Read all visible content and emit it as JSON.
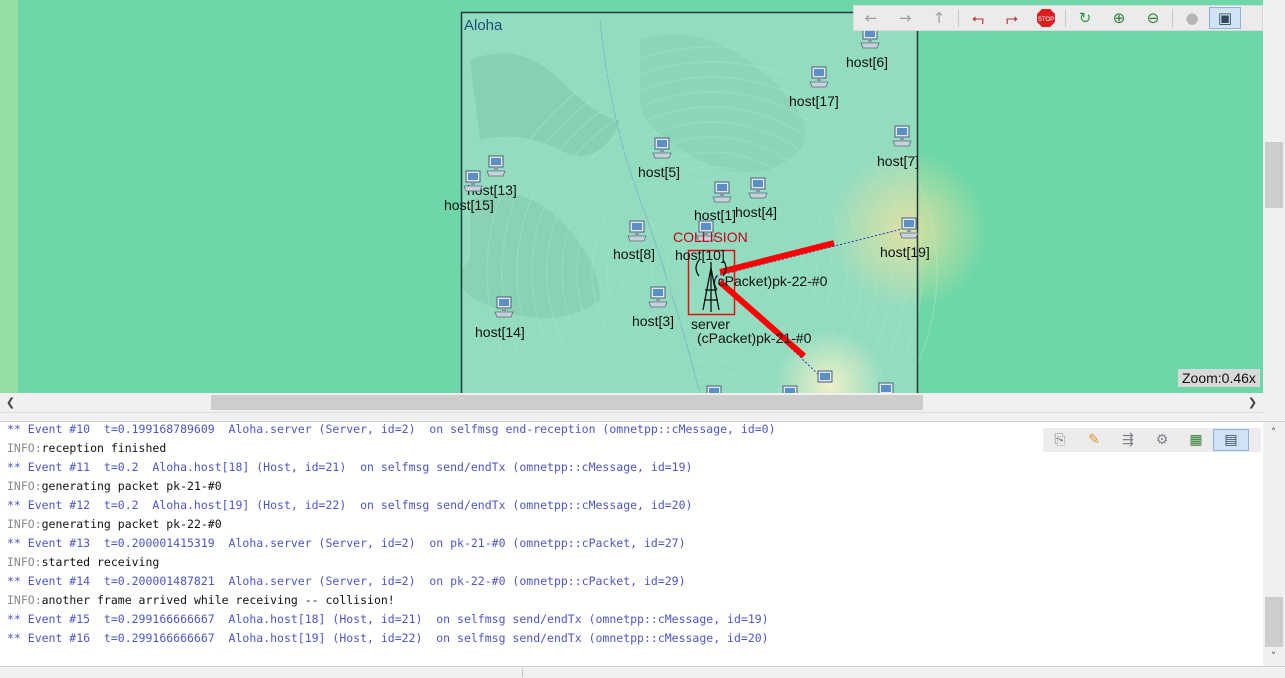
{
  "network": {
    "title": "Aloha",
    "collision_label": "COLLISION",
    "zoom": "Zoom:0.46x",
    "hosts": [
      {
        "name": "host[6]"
      },
      {
        "name": "host[17]"
      },
      {
        "name": "host[7]"
      },
      {
        "name": "host[5]"
      },
      {
        "name": "host[13]"
      },
      {
        "name": "host[15]"
      },
      {
        "name": "host[1]"
      },
      {
        "name": "host[4]"
      },
      {
        "name": "host[10]"
      },
      {
        "name": "host[8]"
      },
      {
        "name": "host[19]"
      },
      {
        "name": "host[3]"
      },
      {
        "name": "host[14]"
      }
    ],
    "server": "server",
    "packets": [
      {
        "label": "(cPacket)pk-22-#0"
      },
      {
        "label": "(cPacket)pk-21-#0"
      }
    ]
  },
  "toolbar": {
    "buttons": [
      {
        "name": "back-icon"
      },
      {
        "name": "forward-icon"
      },
      {
        "name": "up-icon"
      },
      {
        "name": "animate-slower-icon"
      },
      {
        "name": "animate-faster-icon"
      },
      {
        "name": "stop-icon"
      },
      {
        "name": "relayout-icon"
      },
      {
        "name": "zoom-in-icon"
      },
      {
        "name": "zoom-out-icon"
      },
      {
        "name": "circle-icon"
      },
      {
        "name": "mode-icon"
      }
    ],
    "stop_text": "STOP"
  },
  "log": {
    "lines": [
      {
        "kind": "event",
        "text": "** Event #10  t=0.199168789609  Aloha.server (Server, id=2)  on selfmsg end-reception (omnetpp::cMessage, id=0)"
      },
      {
        "kind": "info",
        "tag": "INFO:",
        "text": "reception finished"
      },
      {
        "kind": "event",
        "text": "** Event #11  t=0.2  Aloha.host[18] (Host, id=21)  on selfmsg send/endTx (omnetpp::cMessage, id=19)"
      },
      {
        "kind": "info",
        "tag": "INFO:",
        "text": "generating packet pk-21-#0"
      },
      {
        "kind": "event",
        "text": "** Event #12  t=0.2  Aloha.host[19] (Host, id=22)  on selfmsg send/endTx (omnetpp::cMessage, id=20)"
      },
      {
        "kind": "info",
        "tag": "INFO:",
        "text": "generating packet pk-22-#0"
      },
      {
        "kind": "event",
        "text": "** Event #13  t=0.200001415319  Aloha.server (Server, id=2)  on pk-21-#0 (omnetpp::cPacket, id=27)"
      },
      {
        "kind": "info",
        "tag": "INFO:",
        "text": "started receiving"
      },
      {
        "kind": "event",
        "text": "** Event #14  t=0.200001487821  Aloha.server (Server, id=2)  on pk-22-#0 (omnetpp::cPacket, id=29)"
      },
      {
        "kind": "info",
        "tag": "INFO:",
        "text": "another frame arrived while receiving -- collision!"
      },
      {
        "kind": "event",
        "text": "** Event #15  t=0.299166666667  Aloha.host[18] (Host, id=21)  on selfmsg send/endTx (omnetpp::cMessage, id=19)"
      },
      {
        "kind": "event",
        "text": "** Event #16  t=0.299166666667  Aloha.host[19] (Host, id=22)  on selfmsg send/endTx (omnetpp::cMessage, id=20)"
      }
    ]
  },
  "log_toolbar": {
    "buttons": [
      {
        "name": "copy-icon"
      },
      {
        "name": "find-icon"
      },
      {
        "name": "filter-icon"
      },
      {
        "name": "settings-icon"
      },
      {
        "name": "grid-view-icon"
      },
      {
        "name": "text-view-icon"
      }
    ]
  },
  "colors": {
    "canvas_bg": "#6dd7a8",
    "event_text": "#4d55c9",
    "collision": "#c8001e",
    "packet_line": "#ff0000"
  }
}
